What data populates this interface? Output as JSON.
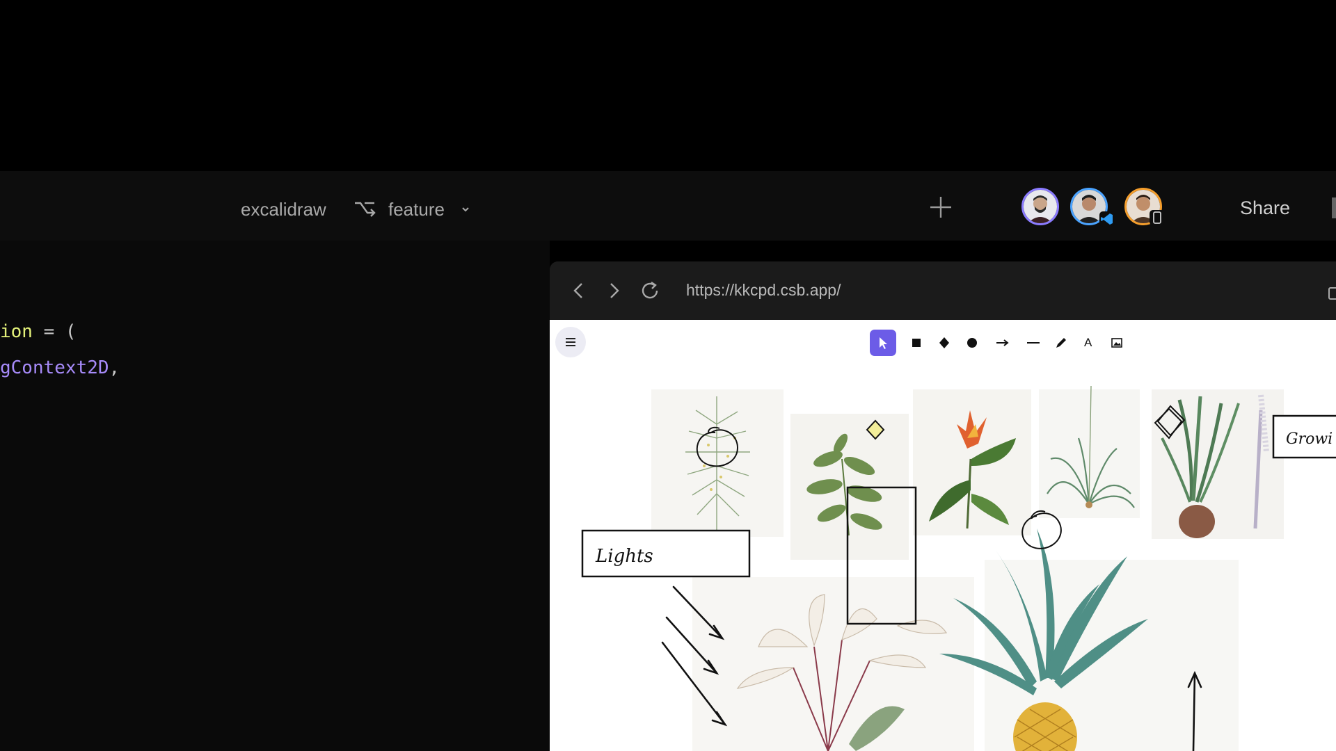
{
  "header": {
    "repo": "excalidraw",
    "branch": "feature",
    "share_label": "Share",
    "avatars": [
      {
        "name": "collaborator-1",
        "ring": "#8b7bff"
      },
      {
        "name": "collaborator-2",
        "ring": "#4aa3ff",
        "badge": "vscode-icon"
      },
      {
        "name": "collaborator-3",
        "ring": "#f59e2c",
        "badge": "phone-icon"
      }
    ]
  },
  "editor": {
    "lines": [
      [
        {
          "text": "ion",
          "kind": "fn"
        },
        {
          "text": " = (",
          "kind": "op"
        }
      ],
      [
        {
          "text": "gContext2D",
          "kind": "ty"
        },
        {
          "text": ",",
          "kind": "op"
        }
      ]
    ]
  },
  "preview": {
    "url": "https://kkcpd.csb.app/",
    "toolbar": [
      {
        "name": "selection-tool",
        "icon": "pointer-icon",
        "active": true
      },
      {
        "name": "rectangle-tool",
        "icon": "square-icon"
      },
      {
        "name": "diamond-tool",
        "icon": "diamond-icon"
      },
      {
        "name": "ellipse-tool",
        "icon": "circle-icon"
      },
      {
        "name": "arrow-tool",
        "icon": "arrow-icon"
      },
      {
        "name": "line-tool",
        "icon": "line-icon"
      },
      {
        "name": "draw-tool",
        "icon": "pencil-icon"
      },
      {
        "name": "text-tool",
        "icon": "text-icon",
        "glyph": "A"
      },
      {
        "name": "image-tool",
        "icon": "image-icon"
      }
    ],
    "canvas_labels": {
      "lights": "Lights",
      "growing": "Growi"
    }
  },
  "colors": {
    "accent": "#6c5ce7",
    "header_bg": "#0d0d0d",
    "editor_bg": "#0a0a0a",
    "canvas_bg": "#ffffff"
  }
}
